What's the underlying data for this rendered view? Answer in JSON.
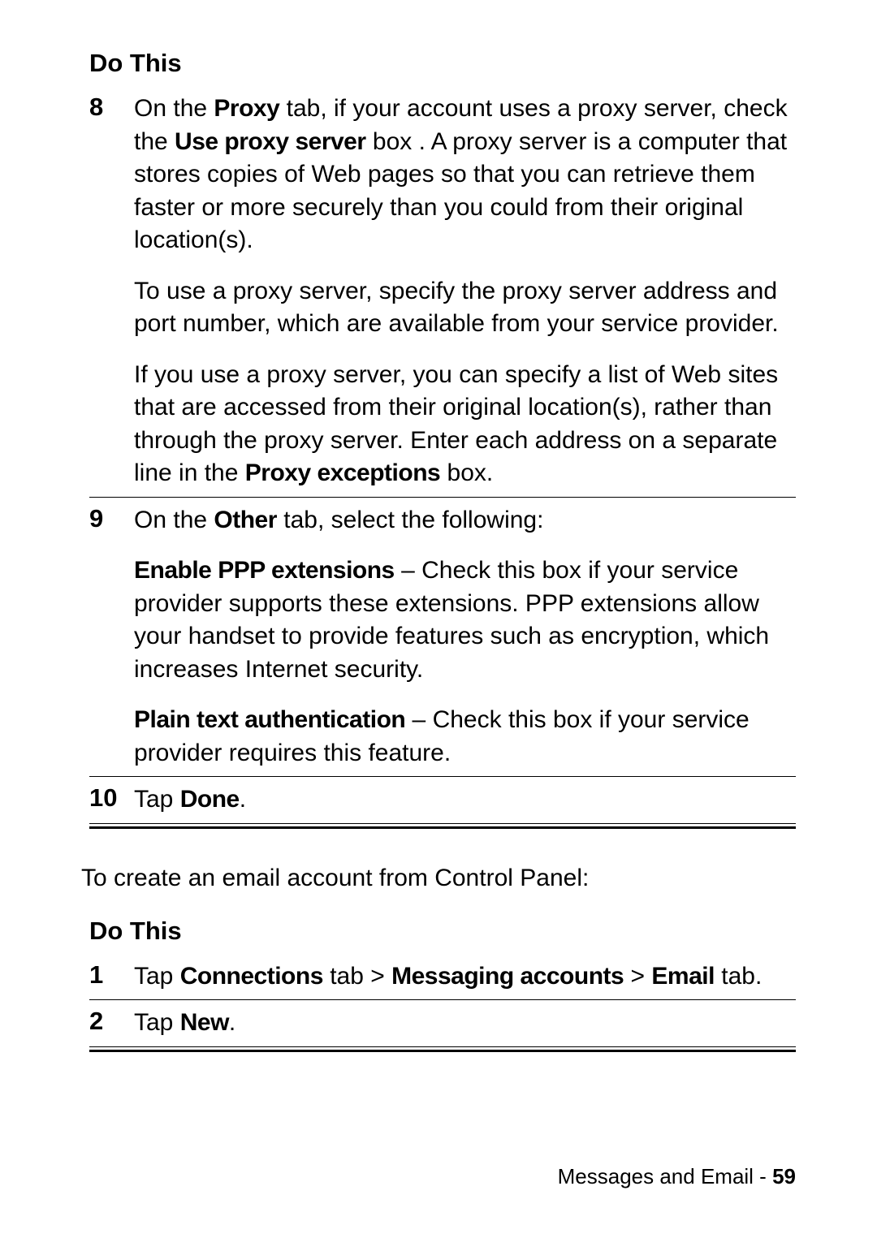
{
  "table1": {
    "heading": "Do This",
    "rows": [
      {
        "num": "8",
        "p1_pre": "On the ",
        "p1_b1": "Proxy",
        "p1_mid1": " tab, if your account uses a proxy server, check the ",
        "p1_b2": "Use proxy server",
        "p1_post": " box . A proxy server is a computer that stores copies of Web pages so that you can retrieve them faster or more securely than you could from their original location(s).",
        "p2": "To use a proxy server, specify the proxy server address and port number, which are available from your service provider.",
        "p3_pre": "If you use a proxy server, you can specify a list of Web sites that are accessed from their original location(s), rather than through the proxy server. Enter each address on a separate line in the ",
        "p3_b1": "Proxy exceptions",
        "p3_post": " box."
      },
      {
        "num": "9",
        "p1_pre": "On the ",
        "p1_b1": "Other",
        "p1_post": " tab, select the following:",
        "p2_b1": "Enable PPP extensions",
        "p2_post": " – Check this box if your service provider supports these extensions. PPP extensions allow your handset to provide features such as encryption, which increases Internet security.",
        "p3_b1": "Plain text authentication",
        "p3_post": " – Check this box if your service provider requires this feature."
      },
      {
        "num": "10",
        "p1_pre": "Tap ",
        "p1_b1": "Done",
        "p1_post": "."
      }
    ]
  },
  "intro": "To create an email account from Control Panel:",
  "table2": {
    "heading": "Do This",
    "rows": [
      {
        "num": "1",
        "p1_pre": "Tap ",
        "p1_b1": "Connections",
        "p1_mid1": " tab > ",
        "p1_b2": "Messaging accounts",
        "p1_mid2": " > ",
        "p1_b3": "Email",
        "p1_post": " tab."
      },
      {
        "num": "2",
        "p1_pre": "Tap ",
        "p1_b1": "New",
        "p1_post": "."
      }
    ]
  },
  "footer": {
    "section": "Messages and Email - ",
    "page": "59"
  }
}
